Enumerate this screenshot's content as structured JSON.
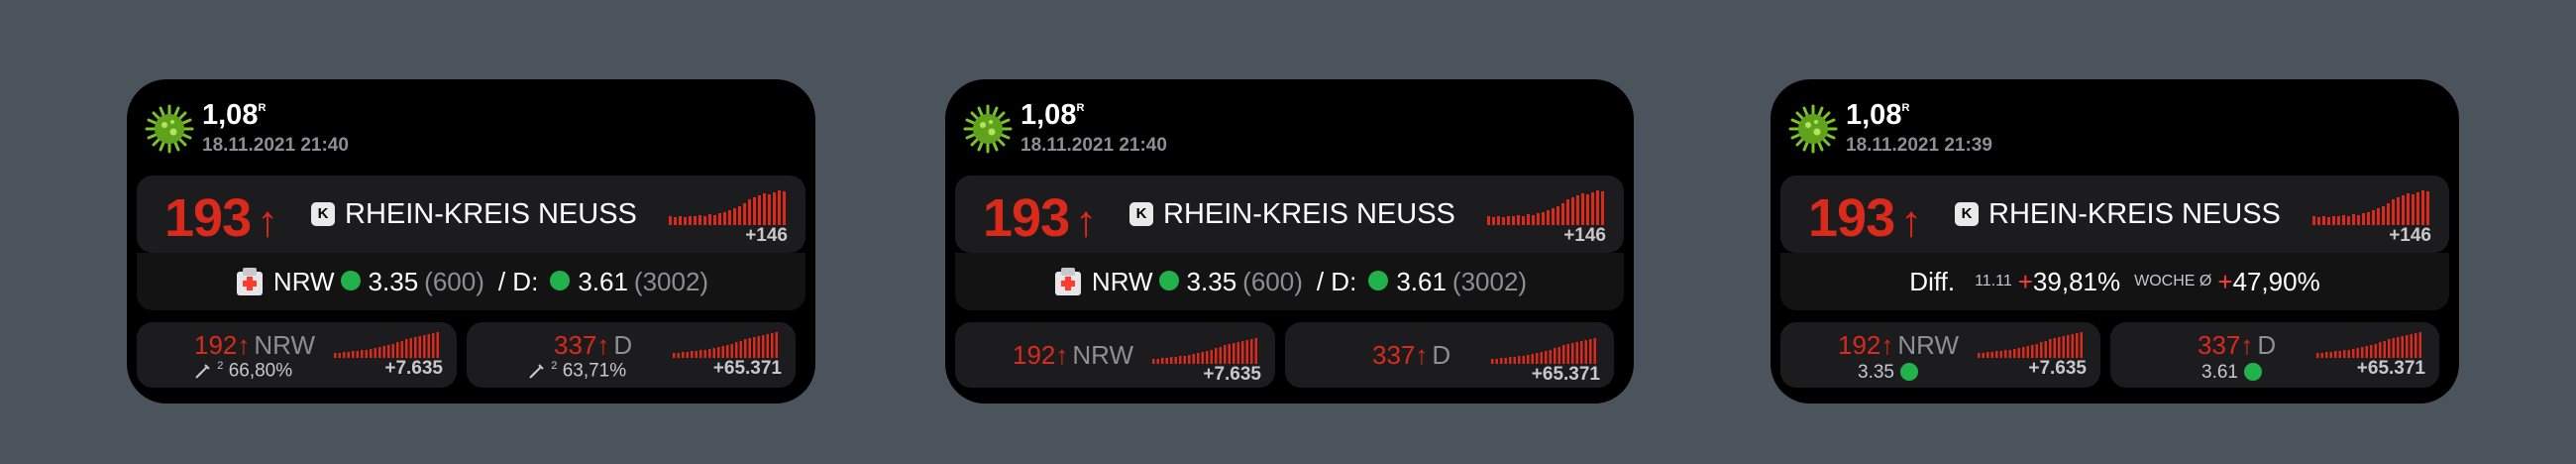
{
  "colors": {
    "background": "#4b535d",
    "widget": "#000000",
    "accent_red": "#d92a1c",
    "status_green": "#21b24b",
    "muted": "#8e8e93"
  },
  "icons": {
    "virus": "virus-icon",
    "hospital": "hospital-icon",
    "syringe": "syringe-icon",
    "arrow": "arrow-up-icon"
  },
  "widgets": [
    {
      "r_value": "1,08",
      "r_sup": "R",
      "timestamp": "18.11.2021 21:40",
      "main": {
        "incidence": "193",
        "arrow": "↑",
        "badge": "K",
        "district": "RHEIN-KREIS NEUSS",
        "delta": "+146"
      },
      "mid": {
        "state": "NRW",
        "state_value": "3.35",
        "state_count": "(600)",
        "sep": "/ D:",
        "de_value": "3.61",
        "de_count": "(3002)"
      },
      "left": {
        "incidence": "192",
        "arrow": "↑",
        "label": "NRW",
        "vac_sup": "2",
        "vac": "66,80%",
        "delta": "+7.635"
      },
      "right": {
        "incidence": "337",
        "arrow": "↑",
        "label": "D",
        "vac_sup": "2",
        "vac": "63,71%",
        "delta": "+65.371"
      }
    },
    {
      "r_value": "1,08",
      "r_sup": "R",
      "timestamp": "18.11.2021 21:40",
      "main": {
        "incidence": "193",
        "arrow": "↑",
        "badge": "K",
        "district": "RHEIN-KREIS NEUSS",
        "delta": "+146"
      },
      "mid": {
        "state": "NRW",
        "state_value": "3.35",
        "state_count": "(600)",
        "sep": "/ D:",
        "de_value": "3.61",
        "de_count": "(3002)"
      },
      "left": {
        "incidence": "192",
        "arrow": "↑",
        "label": "NRW",
        "delta": "+7.635"
      },
      "right": {
        "incidence": "337",
        "arrow": "↑",
        "label": "D",
        "delta": "+65.371"
      }
    },
    {
      "r_value": "1,08",
      "r_sup": "R",
      "timestamp": "18.11.2021 21:39",
      "main": {
        "incidence": "193",
        "arrow": "↑",
        "badge": "K",
        "district": "RHEIN-KREIS NEUSS",
        "delta": "+146"
      },
      "mid": {
        "diff_label": "Diff.",
        "date": "11.11",
        "plus1": "+",
        "diff_value": "39,81%",
        "week_label": "WOCHE Ø",
        "plus2": "+",
        "week_value": "47,90%"
      },
      "left": {
        "incidence": "192",
        "arrow": "↑",
        "label": "NRW",
        "value": "3.35",
        "delta": "+7.635"
      },
      "right": {
        "incidence": "337",
        "arrow": "↑",
        "label": "D",
        "value": "3.61",
        "delta": "+65.371"
      }
    }
  ]
}
